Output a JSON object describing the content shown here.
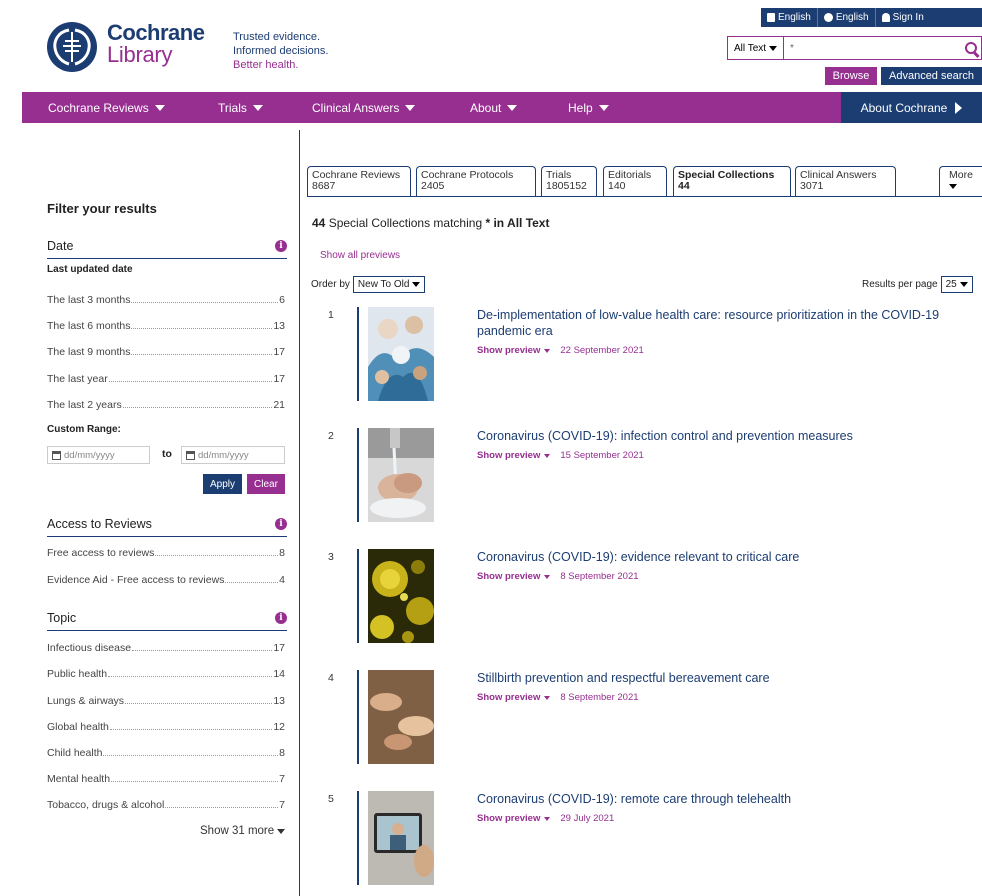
{
  "header": {
    "brand_line1": "Cochrane",
    "brand_line2": "Library",
    "tagline1": "Trusted evidence.",
    "tagline2": "Informed decisions.",
    "tagline3": "Better health.",
    "top_links": [
      "English",
      "English",
      "Sign In"
    ],
    "search": {
      "scope": "All Text",
      "value": "*",
      "placeholder": ""
    },
    "browse_label": "Browse",
    "advanced_label": "Advanced search"
  },
  "nav": {
    "items": [
      "Cochrane Reviews",
      "Trials",
      "Clinical Answers",
      "About",
      "Help"
    ],
    "about_cochrane": "About Cochrane"
  },
  "filters": {
    "title": "Filter your results",
    "date": {
      "heading": "Date",
      "sub": "Last updated date",
      "items": [
        {
          "label": "The last 3 months",
          "count": "6"
        },
        {
          "label": "The last 6 months",
          "count": "13"
        },
        {
          "label": "The last 9 months",
          "count": "17"
        },
        {
          "label": "The last year",
          "count": "17"
        },
        {
          "label": "The last 2 years",
          "count": "21"
        }
      ],
      "custom_range": "Custom Range:",
      "from_placeholder": "dd/mm/yyyy",
      "to_label": "to",
      "to_placeholder": "dd/mm/yyyy",
      "apply": "Apply",
      "clear": "Clear"
    },
    "access": {
      "heading": "Access to Reviews",
      "items": [
        {
          "label": "Free access to reviews",
          "count": "8"
        },
        {
          "label": "Evidence Aid - Free access to reviews",
          "count": "4"
        }
      ]
    },
    "topic": {
      "heading": "Topic",
      "items": [
        {
          "label": "Infectious disease",
          "count": "17"
        },
        {
          "label": "Public health",
          "count": "14"
        },
        {
          "label": "Lungs & airways",
          "count": "13"
        },
        {
          "label": "Global health",
          "count": "12"
        },
        {
          "label": "Child health",
          "count": "8"
        },
        {
          "label": "Mental health",
          "count": "7"
        },
        {
          "label": "Tobacco, drugs & alcohol",
          "count": "7"
        }
      ],
      "show_more": "Show 31 more"
    }
  },
  "tabs": [
    {
      "label": "Cochrane Reviews",
      "count": "8687"
    },
    {
      "label": "Cochrane Protocols",
      "count": "2405"
    },
    {
      "label": "Trials",
      "count": "1805152"
    },
    {
      "label": "Editorials",
      "count": "140"
    },
    {
      "label": "Special Collections",
      "count": "44"
    },
    {
      "label": "Clinical Answers",
      "count": "3071"
    }
  ],
  "more_tab": "More",
  "results_header": {
    "count": "44",
    "text": "Special Collections matching",
    "query": "* in All Text",
    "show_all_previews": "Show all previews",
    "order_by_label": "Order by",
    "order_by_value": "New To Old",
    "per_page_label": "Results per page",
    "per_page_value": "25"
  },
  "results": [
    {
      "num": "1",
      "title": "De-implementation of low-value health care: resource prioritization in the COVID-19 pandemic era",
      "preview": "Show preview",
      "date": "22 September 2021"
    },
    {
      "num": "2",
      "title": "Coronavirus (COVID-19): infection control and prevention measures",
      "preview": "Show preview",
      "date": "15 September 2021"
    },
    {
      "num": "3",
      "title": "Coronavirus (COVID-19): evidence relevant to critical care",
      "preview": "Show preview",
      "date": "8 September 2021"
    },
    {
      "num": "4",
      "title": "Stillbirth prevention and respectful bereavement care",
      "preview": "Show preview",
      "date": "8 September 2021"
    },
    {
      "num": "5",
      "title": "Coronavirus (COVID-19): remote care through telehealth",
      "preview": "Show preview",
      "date": "29 July 2021"
    }
  ],
  "colors": {
    "navy": "#1c3d72",
    "plum": "#962f90"
  }
}
